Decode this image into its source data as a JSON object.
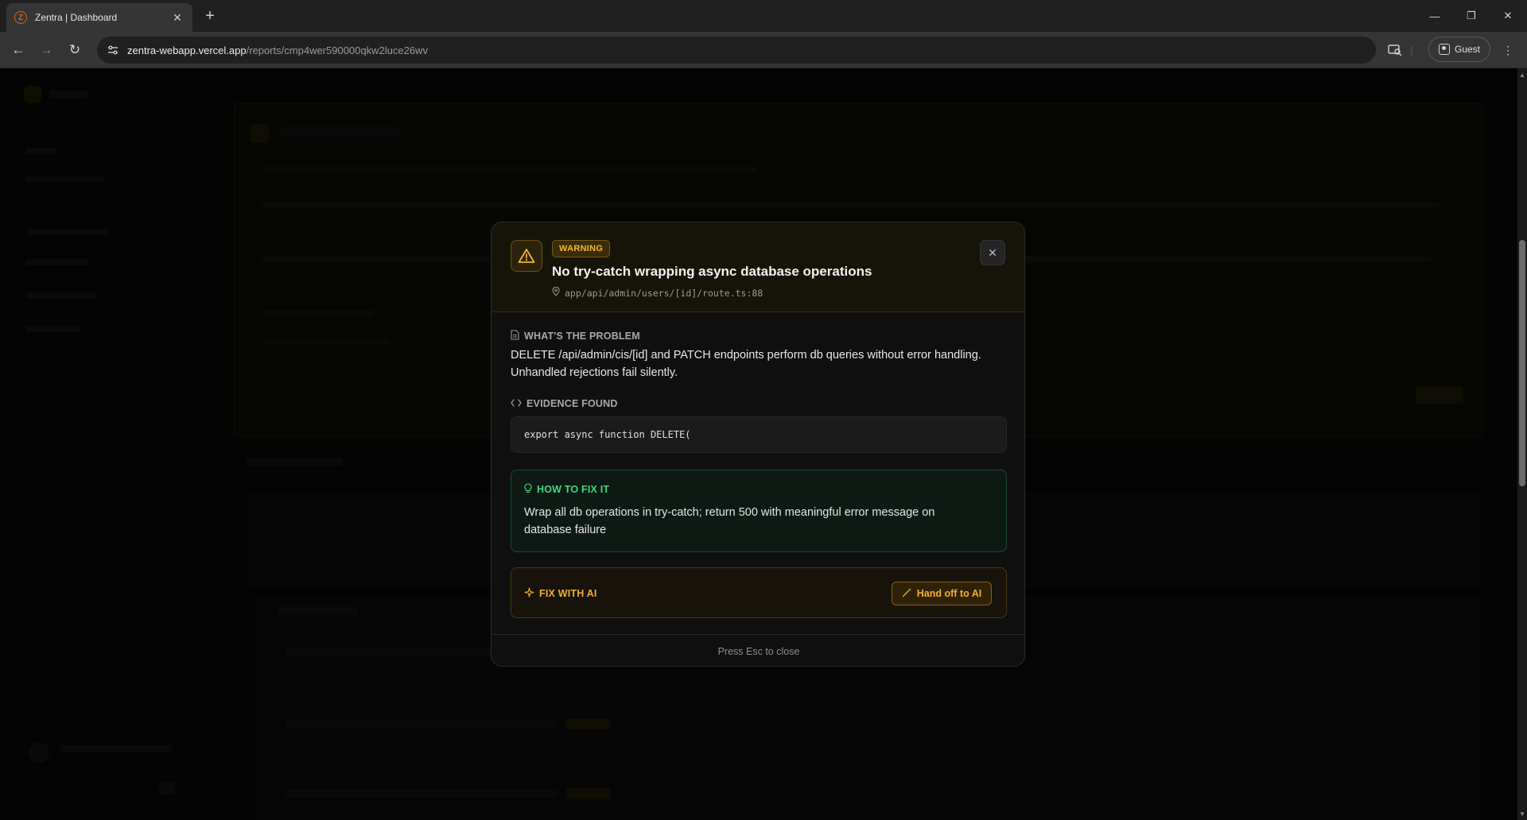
{
  "browser": {
    "tab_title": "Zentra | Dashboard",
    "favicon_letter": "Z",
    "url_host": "zentra-webapp.vercel.app",
    "url_path": "/reports/cmp4wer590000qkw2luce26wv",
    "guest_label": "Guest"
  },
  "modal": {
    "severity": "WARNING",
    "title": "No try-catch wrapping async database operations",
    "location": "app/api/admin/users/[id]/route.ts:88",
    "problem_label": "WHAT'S THE PROBLEM",
    "problem_text": "DELETE /api/admin/cis/[id] and PATCH endpoints perform db queries without error handling. Unhandled rejections fail silently.",
    "evidence_label": "EVIDENCE FOUND",
    "evidence_code": "export async function DELETE(",
    "fix_label": "HOW TO FIX IT",
    "fix_text": "Wrap all db operations in try-catch; return 500 with meaningful error message on database failure",
    "ai_label": "FIX WITH AI",
    "ai_button": "Hand off to AI",
    "footer_hint": "Press Esc to close"
  },
  "colors": {
    "warning": "#f5b82e",
    "fix_green": "#3fd97f",
    "ai_amber": "#f3b02c",
    "modal_bg": "#0f0f0f"
  },
  "icons": {
    "tab_close": "close-icon",
    "new_tab": "plus-icon",
    "back": "arrow-left-icon",
    "forward": "arrow-right-icon",
    "reload": "reload-icon",
    "site_info": "tune-icon",
    "warning": "warning-triangle-icon",
    "location": "map-pin-icon",
    "document": "document-icon",
    "code": "code-brackets-icon",
    "lightbulb": "lightbulb-icon",
    "sparkles": "sparkles-icon",
    "wand": "magic-wand-icon"
  }
}
